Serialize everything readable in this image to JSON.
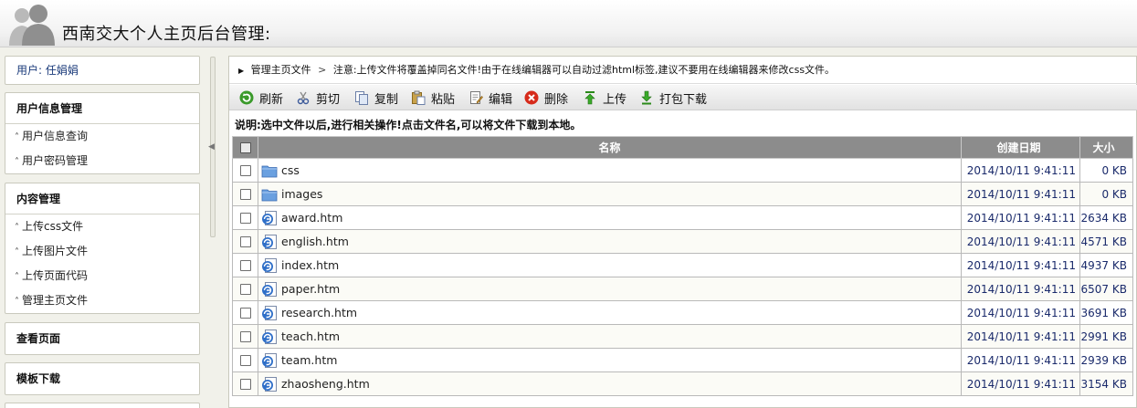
{
  "header": {
    "title": "西南交大个人主页后台管理:"
  },
  "sidebar": {
    "user_label": "用户:",
    "user_name": "任娟娟",
    "sections": [
      {
        "title": "用户信息管理",
        "items": [
          "用户信息查询",
          "用户密码管理"
        ]
      },
      {
        "title": "内容管理",
        "items": [
          "上传css文件",
          "上传图片文件",
          "上传页面代码",
          "管理主页文件"
        ]
      },
      {
        "title": "查看页面",
        "items": []
      },
      {
        "title": "模板下载",
        "items": []
      }
    ]
  },
  "path": {
    "current": "管理主页文件",
    "notice": "注意:上传文件将覆盖掉同名文件!由于在线编辑器可以自动过滤html标签,建议不要用在线编辑器来修改css文件。"
  },
  "toolbar": {
    "refresh": "刷新",
    "cut": "剪切",
    "copy": "复制",
    "paste": "粘贴",
    "edit": "编辑",
    "delete": "删除",
    "upload": "上传",
    "zip_download": "打包下载"
  },
  "note": "说明:选中文件以后,进行相关操作!点击文件名,可以将文件下载到本地。",
  "table": {
    "headers": {
      "name": "名称",
      "date": "创建日期",
      "size": "大小"
    },
    "rows": [
      {
        "name": "css",
        "type": "folder",
        "date": "2014/10/11 9:41:11",
        "size": "0 KB"
      },
      {
        "name": "images",
        "type": "folder",
        "date": "2014/10/11 9:41:11",
        "size": "0 KB"
      },
      {
        "name": "award.htm",
        "type": "htm",
        "date": "2014/10/11 9:41:11",
        "size": "2634 KB"
      },
      {
        "name": "english.htm",
        "type": "htm",
        "date": "2014/10/11 9:41:11",
        "size": "4571 KB"
      },
      {
        "name": "index.htm",
        "type": "htm",
        "date": "2014/10/11 9:41:11",
        "size": "4937 KB"
      },
      {
        "name": "paper.htm",
        "type": "htm",
        "date": "2014/10/11 9:41:11",
        "size": "6507 KB"
      },
      {
        "name": "research.htm",
        "type": "htm",
        "date": "2014/10/11 9:41:11",
        "size": "3691 KB"
      },
      {
        "name": "teach.htm",
        "type": "htm",
        "date": "2014/10/11 9:41:11",
        "size": "2991 KB"
      },
      {
        "name": "team.htm",
        "type": "htm",
        "date": "2014/10/11 9:41:11",
        "size": "2939 KB"
      },
      {
        "name": "zhaosheng.htm",
        "type": "htm",
        "date": "2014/10/11 9:41:11",
        "size": "3154 KB"
      }
    ]
  },
  "colors": {
    "accent": "#1a2a6b",
    "table_header": "#8c8c8c",
    "sidebar_bg": "#f1f1ea"
  }
}
